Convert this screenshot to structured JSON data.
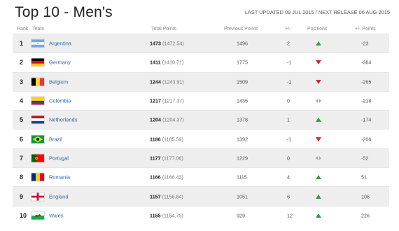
{
  "header": {
    "title": "Top 10 - Men's",
    "update_info": "LAST UPDATED 09 JUL 2015 / NEXT RELEASE 06 AUG 2015"
  },
  "columns": {
    "rank": "Rank",
    "team": "Team",
    "total_points": "Total Points",
    "previous_points": "Previous Points",
    "plus_minus": "+/-",
    "positions": "Positions",
    "plus_minus_points": "+/- Points"
  },
  "rows": [
    {
      "rank": "1",
      "team": "Argentina",
      "flag": "argentina-flag",
      "total": "1473",
      "total_paren": "(1472.54)",
      "previous": "1496",
      "move": "2",
      "trend": "up",
      "diff": "-23"
    },
    {
      "rank": "2",
      "team": "Germany",
      "flag": "germany-flag",
      "total": "1411",
      "total_paren": "(1410.71)",
      "previous": "1775",
      "move": "-1",
      "trend": "down",
      "diff": "-364"
    },
    {
      "rank": "3",
      "team": "Belgium",
      "flag": "belgium-flag",
      "total": "1244",
      "total_paren": "(1243.91)",
      "previous": "1509",
      "move": "-1",
      "trend": "down",
      "diff": "-265"
    },
    {
      "rank": "4",
      "team": "Colombia",
      "flag": "colombia-flag",
      "total": "1217",
      "total_paren": "(1217.37)",
      "previous": "1435",
      "move": "0",
      "trend": "same",
      "diff": "-218"
    },
    {
      "rank": "5",
      "team": "Netherlands",
      "flag": "netherlands-flag",
      "total": "1204",
      "total_paren": "(1204.37)",
      "previous": "1378",
      "move": "1",
      "trend": "up",
      "diff": "-174"
    },
    {
      "rank": "6",
      "team": "Brazil",
      "flag": "brazil-flag",
      "total": "1186",
      "total_paren": "(1185.59)",
      "previous": "1392",
      "move": "-1",
      "trend": "down",
      "diff": "-206"
    },
    {
      "rank": "7",
      "team": "Portugal",
      "flag": "portugal-flag",
      "total": "1177",
      "total_paren": "(1177.06)",
      "previous": "1229",
      "move": "0",
      "trend": "same",
      "diff": "-52"
    },
    {
      "rank": "8",
      "team": "Romania",
      "flag": "romania-flag",
      "total": "1166",
      "total_paren": "(1166.43)",
      "previous": "1115",
      "move": "4",
      "trend": "up",
      "diff": "51"
    },
    {
      "rank": "9",
      "team": "England",
      "flag": "england-flag",
      "total": "1157",
      "total_paren": "(1156.84)",
      "previous": "1051",
      "move": "6",
      "trend": "up",
      "diff": "106"
    },
    {
      "rank": "10",
      "team": "Wales",
      "flag": "wales-flag",
      "total": "1155",
      "total_paren": "(1154.79)",
      "previous": "929",
      "move": "12",
      "trend": "up",
      "diff": "226"
    }
  ],
  "colors": {
    "link": "#2b6aa8",
    "trend_up": "#3a9a44",
    "trend_down": "#c8312b",
    "trend_same": "#aaaaaa",
    "row_shade": "#eeeeee"
  }
}
